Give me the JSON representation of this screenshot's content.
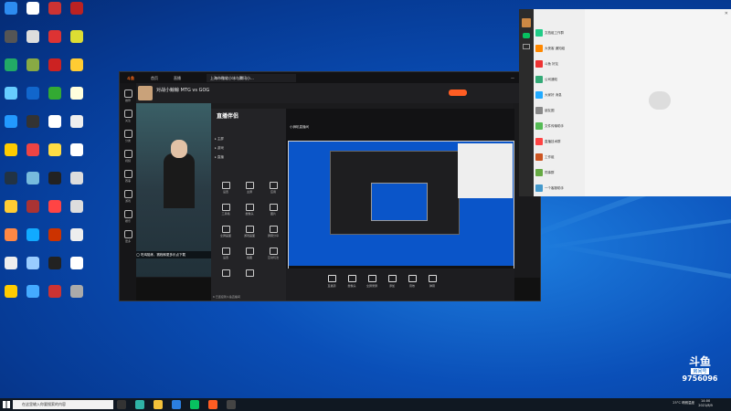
{
  "colors": {
    "accent": "#ff5d23",
    "desktop": "#0a4fb8",
    "douyu_dark": "#1b1b1d",
    "wechat_green": "#07c160"
  },
  "desktop_icons": [
    {
      "name": "app-icon",
      "color": "#2d8cf0"
    },
    {
      "name": "app-icon",
      "color": "#fff"
    },
    {
      "name": "app-icon",
      "color": "#c33"
    },
    {
      "name": "app-icon",
      "color": "#b22"
    },
    {
      "name": "app-icon",
      "color": "#555"
    },
    {
      "name": "app-icon",
      "color": "#ddd"
    },
    {
      "name": "app-icon",
      "color": "#d33"
    },
    {
      "name": "app-icon",
      "color": "#dd3"
    },
    {
      "name": "app-icon",
      "color": "#2a6"
    },
    {
      "name": "app-icon",
      "color": "#8a4"
    },
    {
      "name": "app-icon",
      "color": "#c22"
    },
    {
      "name": "app-icon",
      "color": "#fc3"
    },
    {
      "name": "app-icon",
      "color": "#6cf"
    },
    {
      "name": "app-icon",
      "color": "#16c"
    },
    {
      "name": "app-icon",
      "color": "#3a3"
    },
    {
      "name": "app-icon",
      "color": "#ffd"
    },
    {
      "name": "app-icon",
      "color": "#29f"
    },
    {
      "name": "app-icon",
      "color": "#333"
    },
    {
      "name": "app-icon",
      "color": "#fff"
    },
    {
      "name": "app-icon",
      "color": "#eee"
    },
    {
      "name": "app-icon",
      "color": "#fc0"
    },
    {
      "name": "app-icon",
      "color": "#e44"
    },
    {
      "name": "app-icon",
      "color": "#fd4"
    },
    {
      "name": "app-icon",
      "color": "#fff"
    },
    {
      "name": "app-icon",
      "color": "#234"
    },
    {
      "name": "app-icon",
      "color": "#7bd"
    },
    {
      "name": "app-icon",
      "color": "#222"
    },
    {
      "name": "app-icon",
      "color": "#ddd"
    },
    {
      "name": "app-icon",
      "color": "#fc3"
    },
    {
      "name": "app-icon",
      "color": "#a33"
    },
    {
      "name": "app-icon",
      "color": "#f44"
    },
    {
      "name": "app-icon",
      "color": "#ddd"
    },
    {
      "name": "app-icon",
      "color": "#f84"
    },
    {
      "name": "app-icon",
      "color": "#1af"
    },
    {
      "name": "app-icon",
      "color": "#c30"
    },
    {
      "name": "app-icon",
      "color": "#eee"
    },
    {
      "name": "app-icon",
      "color": "#eee"
    },
    {
      "name": "app-icon",
      "color": "#9cf"
    },
    {
      "name": "app-icon",
      "color": "#222"
    },
    {
      "name": "app-icon",
      "color": "#fff"
    },
    {
      "name": "app-icon",
      "color": "#fc0"
    },
    {
      "name": "app-icon",
      "color": "#4af"
    },
    {
      "name": "app-icon",
      "color": "#c33"
    },
    {
      "name": "app-icon",
      "color": "#aaa"
    }
  ],
  "douyu": {
    "tabs": [
      "斗鱼",
      "首页",
      "直播",
      "上海市微软小冰与腾讯小...",
      "视频"
    ],
    "stream_title": "对战小鲸鲸 MTG vs GOG",
    "side_items": [
      "推荐",
      "关注",
      "分类",
      "视频",
      "赛事",
      "游戏",
      "娱乐",
      "更多"
    ],
    "chat_overlay": "◯ 吃鸡陪练，赛程和更多乐点下载",
    "toolbox": {
      "title": "直播伴侣",
      "items": [
        "设置",
        "主屏",
        "应用",
        "工具箱",
        "摄像头",
        "图片",
        "全屏画面",
        "游戏画面",
        "屏幕分享",
        "设置",
        "截图",
        "互动玩法",
        "",
        ""
      ],
      "footer": "6 已连接到斗鱼直播间"
    },
    "screen": {
      "tab": "小狮吼直播间",
      "ctrl": [
        "直播源",
        "摄像头",
        "全屏录屏",
        "添加",
        "音效",
        "弹幕"
      ]
    },
    "start_button": "开播",
    "right_items": [
      "人气",
      "弹幕",
      "礼物"
    ]
  },
  "wechat": {
    "chats": [
      {
        "name": "文档组工作群",
        "color": "#2c8"
      },
      {
        "name": "大侠客 通知组",
        "color": "#f80"
      },
      {
        "name": "斗鱼 好友",
        "color": "#e33"
      },
      {
        "name": "公司通知",
        "color": "#3a7"
      },
      {
        "name": "大家好 消息",
        "color": "#2af"
      },
      {
        "name": "朋友圈",
        "color": "#888"
      },
      {
        "name": "文件传输助手",
        "color": "#5b5"
      },
      {
        "name": "直播技术群",
        "color": "#f44"
      },
      {
        "name": "工作组",
        "color": "#c52"
      },
      {
        "name": "同事群",
        "color": "#6a4"
      },
      {
        "name": "一个客服助手",
        "color": "#49c"
      }
    ]
  },
  "taskbar": {
    "search_placeholder": "在这里输入你要搜索的内容",
    "tray": "25°C 晴朗温度",
    "time": "14:00",
    "date": "2021/8/5"
  },
  "watermark": {
    "logo": "斗鱼",
    "sub": "房间号",
    "room_id": "9756096"
  }
}
